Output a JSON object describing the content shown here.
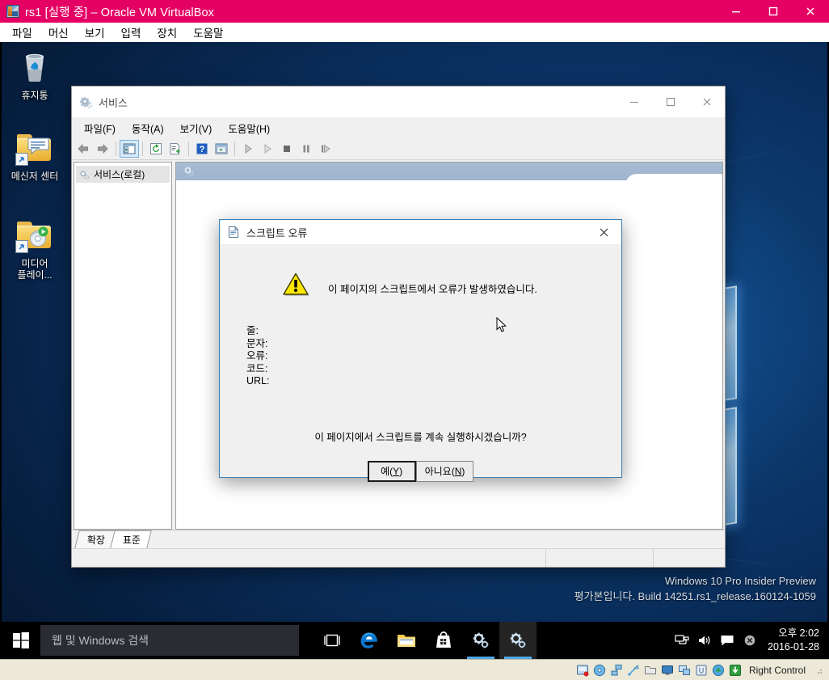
{
  "vbox": {
    "title": "rs1 [실행 중] – Oracle VM VirtualBox",
    "menus": [
      "파일",
      "머신",
      "보기",
      "입력",
      "장치",
      "도움말"
    ],
    "window_buttons": {
      "minimize": "minimize",
      "maximize": "maximize",
      "close": "close"
    },
    "statusbar": {
      "host_key": "Right Control",
      "indicators": [
        "hard-disk-indicator",
        "optical-disk-indicator",
        "network-indicator",
        "usb-indicator",
        "shared-folder-indicator",
        "display-indicator",
        "remote-desktop-indicator",
        "video-capture-indicator",
        "mouse-integration-indicator",
        "guest-additions-indicator"
      ]
    },
    "accent_color": "#e50063"
  },
  "desktop": {
    "icons": [
      {
        "label": "휴지통",
        "icon": "recycle-bin-icon",
        "type": "recycle"
      },
      {
        "label": "메신저 센터",
        "icon": "messenger-folder-icon",
        "type": "messenger"
      },
      {
        "label": "미디어\n플레이...",
        "icon": "media-player-folder-icon",
        "type": "media"
      }
    ],
    "watermark": {
      "line1": "Windows 10 Pro Insider Preview",
      "line2": "평가본입니다. Build 14251.rs1_release.160124-1059"
    }
  },
  "services_window": {
    "title": "서비스",
    "title_icon": "services-gear-icon",
    "menus": [
      "파일(F)",
      "동작(A)",
      "보기(V)",
      "도움말(H)"
    ],
    "toolbar": [
      {
        "name": "back-button",
        "icon": "back-arrow-icon",
        "active": false
      },
      {
        "name": "forward-button",
        "icon": "forward-arrow-icon",
        "active": false
      },
      {
        "name": "show-hide-tree-button",
        "icon": "console-tree-icon",
        "active": true
      },
      {
        "name": "refresh-button",
        "icon": "refresh-icon",
        "active": false
      },
      {
        "name": "export-list-button",
        "icon": "export-list-icon",
        "active": false
      },
      {
        "name": "help-button",
        "icon": "help-question-icon",
        "active": false
      },
      {
        "name": "properties-button",
        "icon": "properties-icon",
        "active": false
      },
      {
        "name": "start-service-button",
        "icon": "play-icon",
        "active": false
      },
      {
        "name": "resume-service-button",
        "icon": "play-outline-icon",
        "active": false
      },
      {
        "name": "stop-service-button",
        "icon": "stop-square-icon",
        "active": false
      },
      {
        "name": "pause-service-button",
        "icon": "pause-bars-icon",
        "active": false
      },
      {
        "name": "restart-service-button",
        "icon": "restart-icon",
        "active": false
      }
    ],
    "tree": [
      {
        "label": "서비스(로컬)",
        "icon": "services-node-icon",
        "selected": true
      }
    ],
    "tabs": [
      {
        "label": "확장",
        "active": false
      },
      {
        "label": "표준",
        "active": true
      }
    ],
    "status_panes": [
      "",
      "",
      ""
    ],
    "window_buttons": {
      "minimize": "minimize",
      "maximize": "maximize",
      "close": "close"
    }
  },
  "dialog": {
    "title": "스크립트 오류",
    "title_icon": "script-document-icon",
    "warning_icon": "warning-triangle-icon",
    "message": "이 페이지의 스크립트에서 오류가 발생하였습니다.",
    "fields": [
      {
        "label": "줄:",
        "value": ""
      },
      {
        "label": "문자:",
        "value": ""
      },
      {
        "label": "오류:",
        "value": ""
      },
      {
        "label": "코드:",
        "value": ""
      },
      {
        "label": "URL:",
        "value": ""
      }
    ],
    "question": "이 페이지에서 스크립트를 계속 실행하시겠습니까?",
    "buttons": [
      {
        "label_pre": "예(",
        "accel": "Y",
        "label_post": ")",
        "default": true
      },
      {
        "label_pre": "아니요(",
        "accel": "N",
        "label_post": ")",
        "default": false
      }
    ],
    "close_label": "close"
  },
  "taskbar": {
    "start": "start-button",
    "search_placeholder": "웹 및 Windows 검색",
    "apps": [
      {
        "name": "task-view-button",
        "icon": "task-view-icon",
        "running": false,
        "active": false
      },
      {
        "name": "edge-button",
        "icon": "edge-icon",
        "running": false,
        "active": false
      },
      {
        "name": "file-explorer-button",
        "icon": "file-explorer-icon",
        "running": false,
        "active": false
      },
      {
        "name": "store-button",
        "icon": "store-icon",
        "running": false,
        "active": false
      },
      {
        "name": "services-taskbar-button",
        "icon": "services-gear-icon",
        "running": true,
        "active": false
      },
      {
        "name": "services-taskbar-button-2",
        "icon": "services-gear-icon",
        "running": true,
        "active": true
      }
    ],
    "tray": [
      {
        "name": "network-tray-icon",
        "icon": "network-icon"
      },
      {
        "name": "volume-tray-icon",
        "icon": "speaker-icon"
      },
      {
        "name": "action-center-tray-icon",
        "icon": "chat-icon"
      },
      {
        "name": "error-tray-icon",
        "icon": "error-circle-icon"
      }
    ],
    "clock": {
      "time": "오후 2:02",
      "date": "2016-01-28"
    }
  }
}
